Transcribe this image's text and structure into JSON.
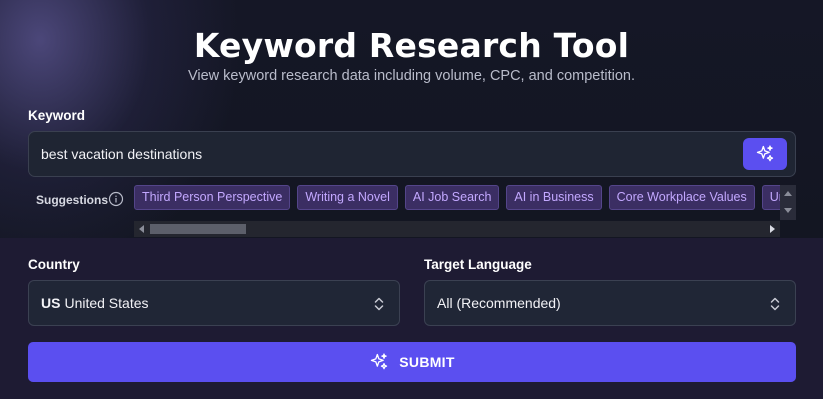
{
  "header": {
    "title": "Keyword Research Tool",
    "subtitle": "View keyword research data including volume, CPC, and competition."
  },
  "keyword": {
    "label": "Keyword",
    "value": "best vacation destinations"
  },
  "suggestions": {
    "label": "Suggestions",
    "items": [
      "Third Person Perspective",
      "Writing a Novel",
      "AI Job Search",
      "AI in Business",
      "Core Workplace Values",
      "Universal Design"
    ]
  },
  "country": {
    "label": "Country",
    "flag": "US",
    "value": "United States"
  },
  "language": {
    "label": "Target Language",
    "value": "All (Recommended)"
  },
  "submit": {
    "label": "SUBMIT"
  },
  "colors": {
    "accent": "#5b4ff0",
    "chip_text": "#c3a8ff",
    "chip_bg": "#3b2e63"
  },
  "icons": [
    "sparkle-icon",
    "info-icon",
    "chevron-updown-icon"
  ]
}
